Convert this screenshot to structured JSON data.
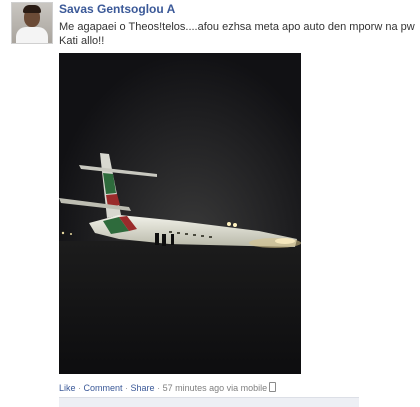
{
  "post": {
    "author": "Savas Gentsoglou A",
    "message": "Me agapaei o Theos!telos....afou ezhsa meta apo auto den mporw na pw Kati allo!!"
  },
  "actions": {
    "like": "Like",
    "comment": "Comment",
    "share": "Share",
    "separator": " · ",
    "timestamp": "57 minutes ago via mobile"
  },
  "icons": {
    "avatar": "profile-photo",
    "mobile": "mobile-phone-icon"
  },
  "colors": {
    "link": "#3b5998",
    "text": "#333333",
    "meta": "#7f7f7f"
  }
}
